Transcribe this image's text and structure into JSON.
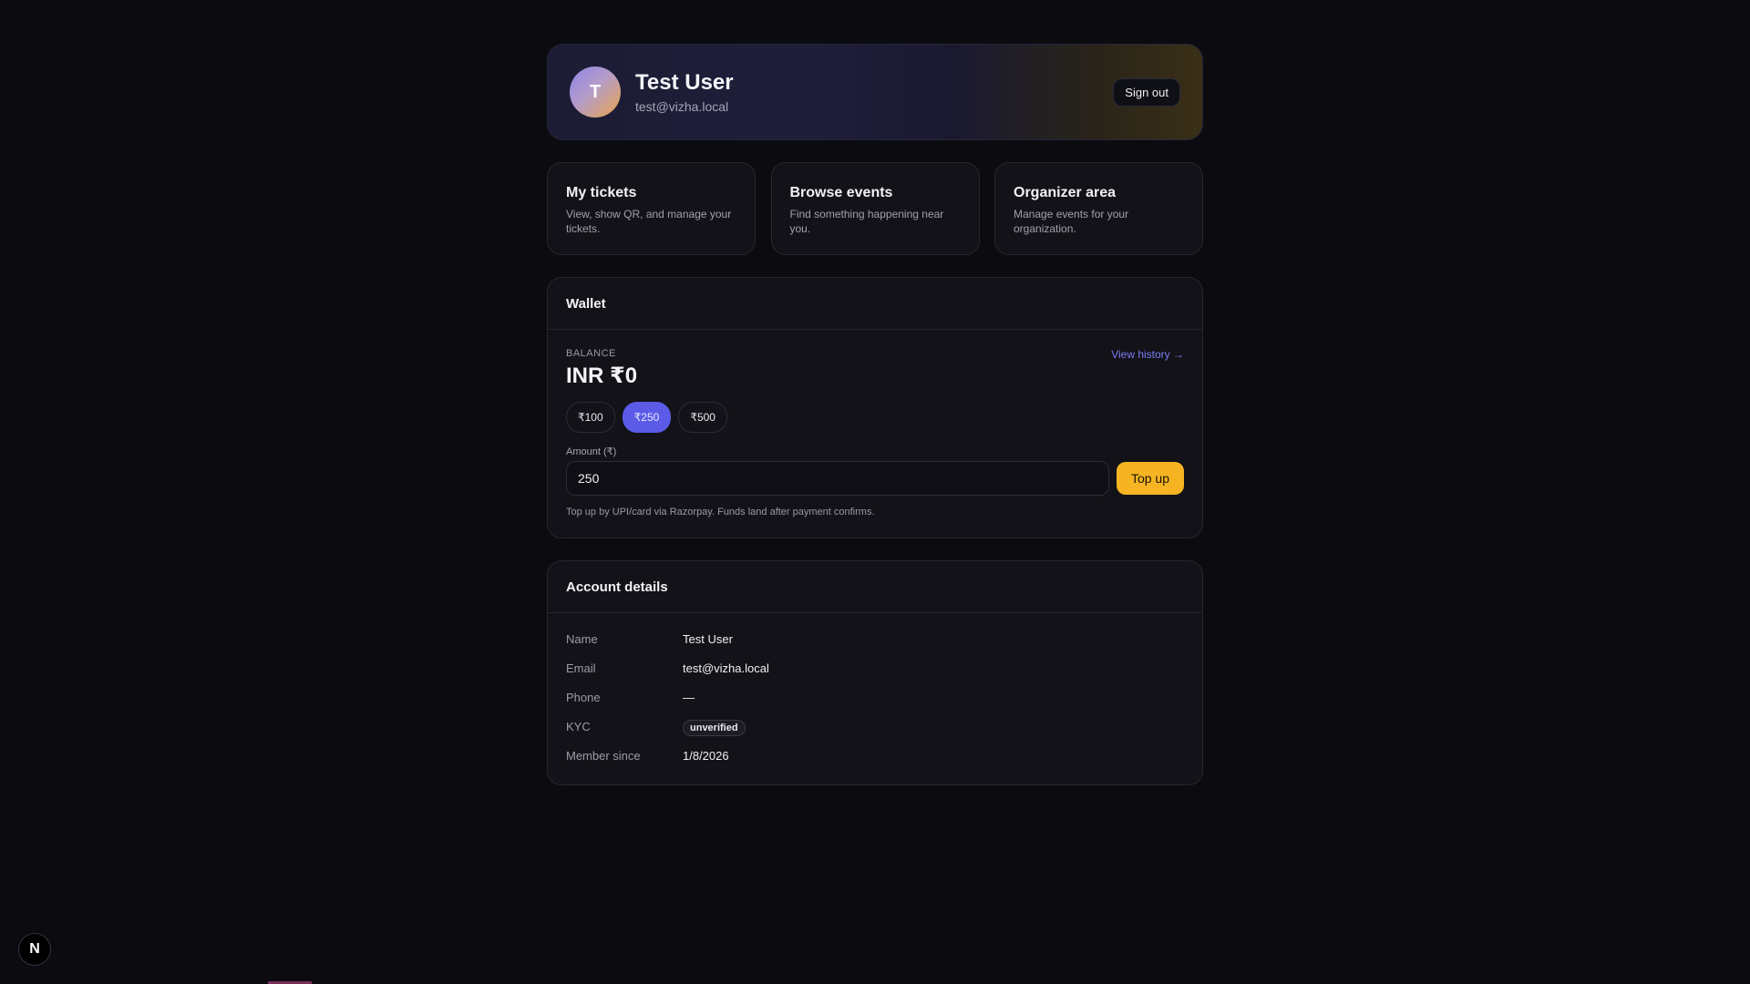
{
  "profile": {
    "avatar_initial": "T",
    "name": "Test User",
    "email": "test@vizha.local",
    "signout_label": "Sign out"
  },
  "quick_links": [
    {
      "title": "My tickets",
      "description": "View, show QR, and manage your tickets."
    },
    {
      "title": "Browse events",
      "description": "Find something happening near you."
    },
    {
      "title": "Organizer area",
      "description": "Manage events for your organization."
    }
  ],
  "wallet": {
    "title": "Wallet",
    "balance_label": "BALANCE",
    "balance_value": "INR ₹0",
    "view_history_label": "View history →",
    "presets": [
      "₹100",
      "₹250",
      "₹500"
    ],
    "selected_preset": "₹250",
    "amount_label": "Amount (₹)",
    "amount_value": "250",
    "topup_label": "Top up",
    "note": "Top up by UPI/card via Razorpay. Funds land after payment confirms."
  },
  "account": {
    "title": "Account details",
    "rows": {
      "name": {
        "label": "Name",
        "value": "Test User"
      },
      "email": {
        "label": "Email",
        "value": "test@vizha.local"
      },
      "phone": {
        "label": "Phone",
        "value": "—"
      },
      "kyc": {
        "label": "KYC",
        "value": "unverified"
      },
      "member_since": {
        "label": "Member since",
        "value": "1/8/2026"
      }
    }
  },
  "dev_badge": {
    "label": "N"
  },
  "colors": {
    "background": "#0b0b10",
    "accent": "#5b5be8",
    "topup": "#f6b422",
    "link": "#7c7cf4"
  }
}
